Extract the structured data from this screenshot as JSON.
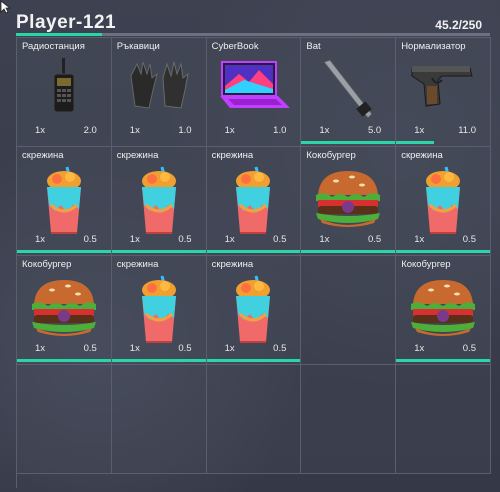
{
  "player": {
    "name": "Player-121",
    "weight": "45.2/250",
    "weight_fraction": 0.181
  },
  "colors": {
    "accent": "#2ad6a8",
    "background": "#3a3e4c",
    "grid_line": "#5a5e6e"
  },
  "slots": [
    {
      "name": "Радиостанция",
      "qty": "1x",
      "weight": "2.0",
      "icon": "radio-icon",
      "durability": 0
    },
    {
      "name": "Ръкавици",
      "qty": "1x",
      "weight": "1.0",
      "icon": "gloves-icon",
      "durability": 0
    },
    {
      "name": "CyberBook",
      "qty": "1x",
      "weight": "1.0",
      "icon": "laptop-icon",
      "durability": 0
    },
    {
      "name": "Bat",
      "qty": "1x",
      "weight": "5.0",
      "icon": "bat-icon",
      "durability": 1.0
    },
    {
      "name": "Нормализатор",
      "qty": "1x",
      "weight": "11.0",
      "icon": "pistol-icon",
      "durability": 0.4
    },
    {
      "name": "скрежина",
      "qty": "1x",
      "weight": "0.5",
      "icon": "drink-icon",
      "durability": 1.0
    },
    {
      "name": "скрежина",
      "qty": "1x",
      "weight": "0.5",
      "icon": "drink-icon",
      "durability": 1.0
    },
    {
      "name": "скрежина",
      "qty": "1x",
      "weight": "0.5",
      "icon": "drink-icon",
      "durability": 1.0
    },
    {
      "name": "Кокобургер",
      "qty": "1x",
      "weight": "0.5",
      "icon": "burger-icon",
      "durability": 1.0
    },
    {
      "name": "скрежина",
      "qty": "1x",
      "weight": "0.5",
      "icon": "drink-icon",
      "durability": 1.0
    },
    {
      "name": "Кокобургер",
      "qty": "1x",
      "weight": "0.5",
      "icon": "burger-icon",
      "durability": 1.0
    },
    {
      "name": "скрежина",
      "qty": "1x",
      "weight": "0.5",
      "icon": "drink-icon",
      "durability": 1.0
    },
    {
      "name": "скрежина",
      "qty": "1x",
      "weight": "0.5",
      "icon": "drink-icon",
      "durability": 1.0
    },
    null,
    {
      "name": "Кокобургер",
      "qty": "1x",
      "weight": "0.5",
      "icon": "burger-icon",
      "durability": 1.0
    },
    null,
    null,
    null,
    null,
    null
  ]
}
